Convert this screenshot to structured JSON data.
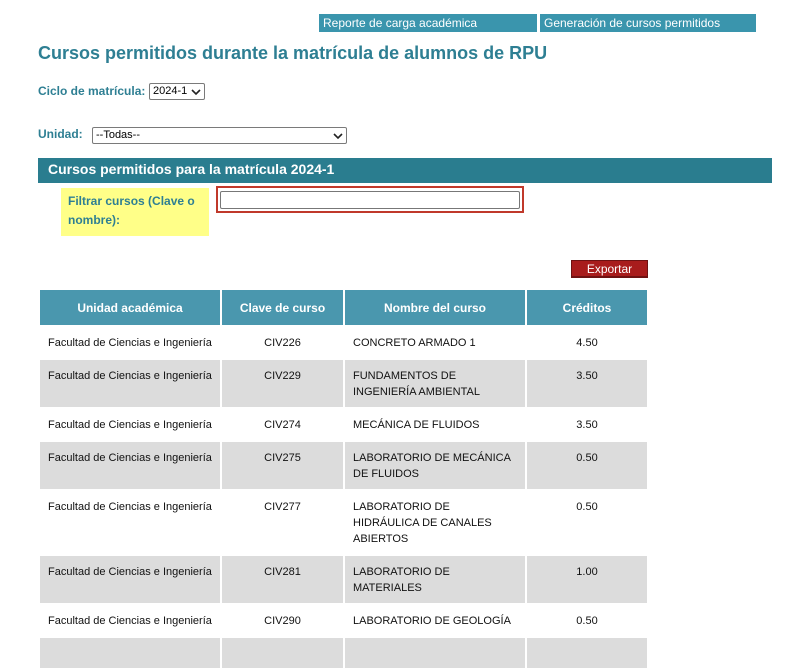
{
  "nav": {
    "report_link": "Reporte de carga académica",
    "generation_link": "Generación de cursos permitidos"
  },
  "page_title": "Cursos permitidos durante la matrícula de alumnos de RPU",
  "cycle": {
    "label": "Ciclo de matrícula:",
    "selected": "2024-1"
  },
  "unit": {
    "label": "Unidad:",
    "selected": "--Todas--"
  },
  "section_title": "Cursos permitidos para la matrícula 2024-1",
  "filter": {
    "label": "Filtrar cursos (Clave o nombre):",
    "value": ""
  },
  "export_label": "Exportar",
  "table": {
    "headers": [
      "Unidad académica",
      "Clave de curso",
      "Nombre del curso",
      "Créditos"
    ],
    "rows": [
      [
        "Facultad de Ciencias e Ingeniería",
        "CIV226",
        "CONCRETO ARMADO 1",
        "4.50"
      ],
      [
        "Facultad de Ciencias e Ingeniería",
        "CIV229",
        "FUNDAMENTOS DE INGENIERÍA AMBIENTAL",
        "3.50"
      ],
      [
        "Facultad de Ciencias e Ingeniería",
        "CIV274",
        "MECÁNICA DE FLUIDOS",
        "3.50"
      ],
      [
        "Facultad de Ciencias e Ingeniería",
        "CIV275",
        "LABORATORIO DE MECÁNICA DE FLUIDOS",
        "0.50"
      ],
      [
        "Facultad de Ciencias e Ingeniería",
        "CIV277",
        "LABORATORIO DE HIDRÁULICA DE CANALES ABIERTOS",
        "0.50"
      ],
      [
        "Facultad de Ciencias e Ingeniería",
        "CIV281",
        "LABORATORIO DE MATERIALES",
        "1.00"
      ],
      [
        "Facultad de Ciencias e Ingeniería",
        "CIV290",
        "LABORATORIO DE GEOLOGÍA",
        "0.50"
      ],
      [
        "",
        "",
        "",
        ""
      ]
    ]
  },
  "colors": {
    "accent": "#3a95ad",
    "title": "#2e7f93",
    "section_bar": "#2a7d8f",
    "export": "#a81c1c",
    "highlight": "#ffff88"
  }
}
